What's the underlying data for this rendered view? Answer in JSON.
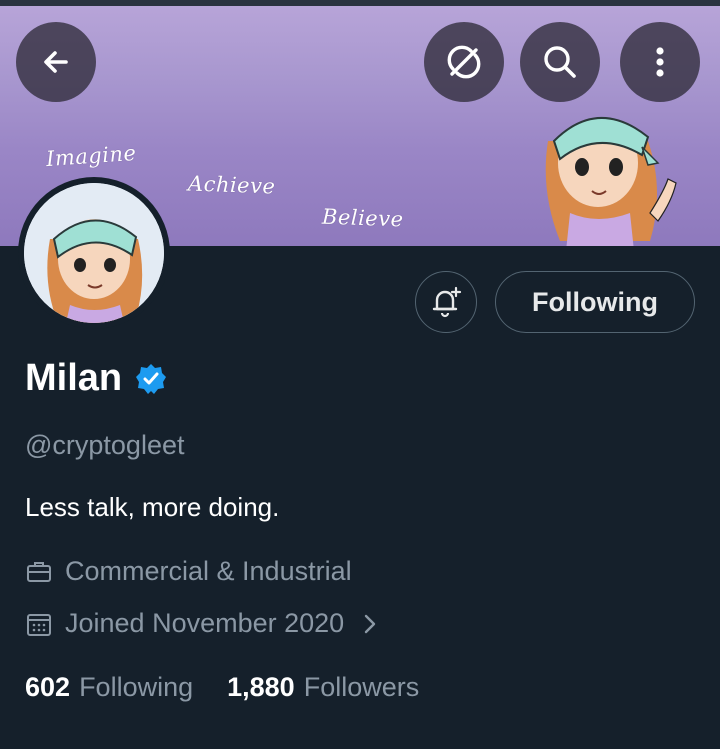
{
  "banner": {
    "words": [
      "Imagine",
      "Achieve",
      "Believe"
    ],
    "color": "#a897cf"
  },
  "toolbar": {
    "icons": [
      "back-arrow-icon",
      "grok-icon",
      "search-icon",
      "more-vertical-icon"
    ]
  },
  "profile": {
    "name": "Milan",
    "handle": "@cryptogleet",
    "bio": "Less talk, more doing.",
    "category": "Commercial & Industrial",
    "joined": "Joined November 2020",
    "verified_color": "#1d9bf0"
  },
  "actions": {
    "notify_icon": "bell-plus-icon",
    "follow_label": "Following"
  },
  "stats": {
    "following_count": "602",
    "following_label": "Following",
    "followers_count": "1,880",
    "followers_label": "Followers"
  }
}
